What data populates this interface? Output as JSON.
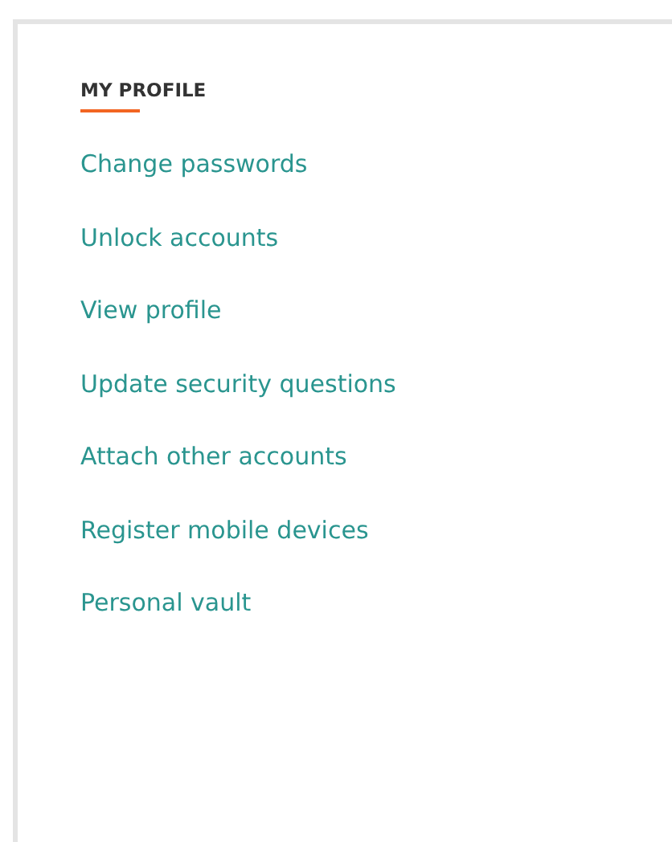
{
  "panel": {
    "title": "MY PROFILE",
    "links": [
      "Change passwords",
      "Unlock accounts",
      "View profile",
      "Update security questions",
      "Attach other accounts",
      "Register mobile devices",
      "Personal vault"
    ]
  }
}
